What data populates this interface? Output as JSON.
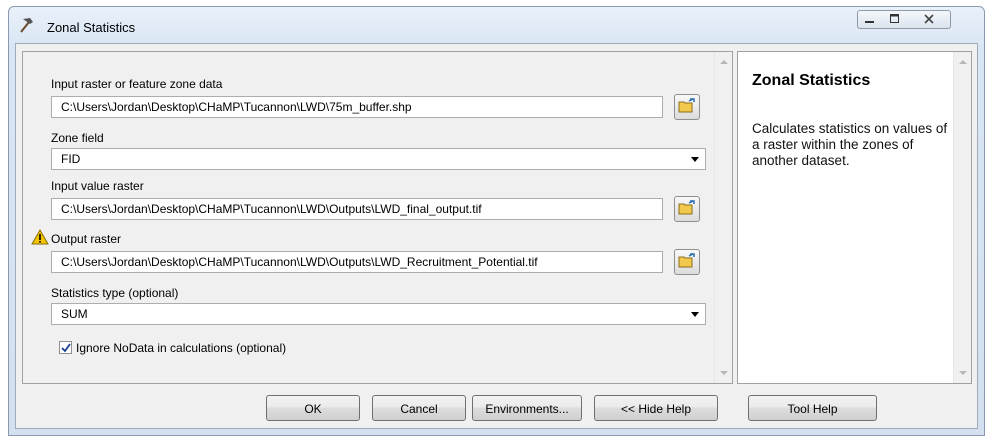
{
  "window": {
    "title": "Zonal Statistics",
    "icon": "hammer-icon",
    "controls": [
      "minimize-icon",
      "maximize-icon",
      "close-icon"
    ]
  },
  "params": [
    {
      "label": "Input raster or feature zone data",
      "value": "C:\\Users\\Jordan\\Desktop\\CHaMP\\Tucannon\\LWD\\75m_buffer.shp"
    },
    {
      "label": "Zone field",
      "value": "FID"
    },
    {
      "label": "Input value raster",
      "value": "C:\\Users\\Jordan\\Desktop\\CHaMP\\Tucannon\\LWD\\Outputs\\LWD_final_output.tif"
    },
    {
      "label": "Output raster",
      "value": "C:\\Users\\Jordan\\Desktop\\CHaMP\\Tucannon\\LWD\\Outputs\\LWD_Recruitment_Potential.tif",
      "warning_icon": "warning-icon"
    },
    {
      "label": "Statistics type (optional)",
      "value": "SUM"
    }
  ],
  "checkbox": {
    "label": "Ignore NoData in calculations (optional)",
    "checked": true
  },
  "help": {
    "title": "Zonal Statistics",
    "body": "Calculates statistics on values of a raster within the zones of another dataset."
  },
  "buttons": {
    "ok": "OK",
    "cancel": "Cancel",
    "environments": "Environments...",
    "hide_help": "<< Hide Help",
    "tool_help": "Tool Help"
  },
  "colors": {
    "titlebar": "#d9e6f4",
    "panel": "#f0f0f0",
    "warning": "#f5c400"
  }
}
